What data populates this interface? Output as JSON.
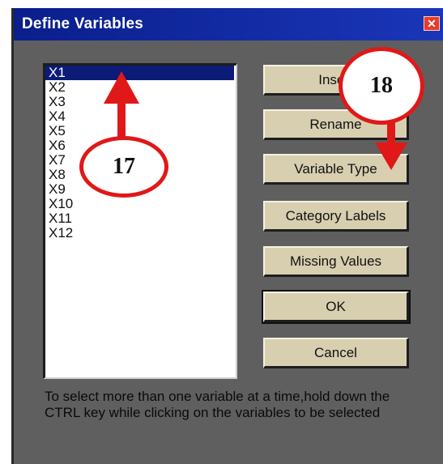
{
  "window": {
    "title": "Define Variables",
    "close_glyph": "✕"
  },
  "variables": [
    "X1",
    "X2",
    "X3",
    "X4",
    "X5",
    "X6",
    "X7",
    "X8",
    "X9",
    "X10",
    "X11",
    "X12"
  ],
  "selected_variable": "X1",
  "buttons": {
    "insert": "Insert",
    "rename": "Rename",
    "variable_type": "Variable Type",
    "category_labels": "Category Labels",
    "missing_values": "Missing Values",
    "ok": "OK",
    "cancel": "Cancel"
  },
  "hint": "To select more than one variable at a time,hold down the CTRL key while clicking on the variables to be selected",
  "annotations": {
    "left_marker": "17",
    "right_marker": "18",
    "color": "#e01818"
  }
}
